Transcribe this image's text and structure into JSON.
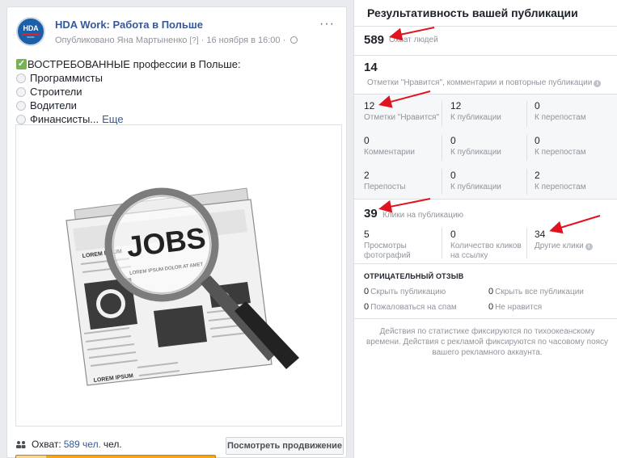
{
  "post": {
    "page_name": "HDA Work: Работа в Польше",
    "avatar_text": "HDA",
    "avatar_subtext": "WORK",
    "meta": "Опубликовано Яна Мартыненко",
    "meta_help": "[?]",
    "meta_date": "· 16 ноября в 16:00 ·",
    "more": "···",
    "intro_line": "ВОСТРЕБОВАННЫЕ профессии в Польше:",
    "list_items": [
      "Программисты",
      "Строители",
      "Водители",
      "Финансисты..."
    ],
    "see_more": "Еще",
    "image_words": {
      "jobs": "JOBS",
      "lorem1": "LOREM IPSUM",
      "lorem2": "LOREM IPSUM",
      "dolor": "LOREM IPSUM DOLOR AT AMET"
    },
    "reach_label": "Охват:",
    "reach_value": "589 чел.",
    "reach_unit": "чел.",
    "reach_fraction": 0.15,
    "boost_button": "Посмотреть продвижение"
  },
  "perf": {
    "title": "Результативность вашей публикации",
    "reach": {
      "value": "589",
      "label": "Охват людей"
    },
    "engagement": {
      "value": "14",
      "label": "Отметки \"Нравится\", комментарии и повторные публикации",
      "info": "i"
    },
    "grid": [
      [
        {
          "value": "12",
          "label": "Отметки \"Нравится\""
        },
        {
          "value": "12",
          "label": "К публикации"
        },
        {
          "value": "0",
          "label": "К перепостам"
        }
      ],
      [
        {
          "value": "0",
          "label": "Комментарии"
        },
        {
          "value": "0",
          "label": "К публикации"
        },
        {
          "value": "0",
          "label": "К перепостам"
        }
      ],
      [
        {
          "value": "2",
          "label": "Перепосты"
        },
        {
          "value": "0",
          "label": "К публикации"
        },
        {
          "value": "2",
          "label": "К перепостам"
        }
      ]
    ],
    "clicks": {
      "value": "39",
      "label": "Клики на публикацию"
    },
    "click_breakdown": [
      {
        "value": "5",
        "label": "Просмотры фотографий"
      },
      {
        "value": "0",
        "label": "Количество кликов на ссылку"
      },
      {
        "value": "34",
        "label": "Другие клики",
        "info": "i"
      }
    ],
    "negative_title": "ОТРИЦАТЕЛЬНЫЙ ОТЗЫВ",
    "negative": [
      {
        "value": "0",
        "label": "Скрыть публикацию"
      },
      {
        "value": "0",
        "label": "Скрыть все публикации"
      },
      {
        "value": "0",
        "label": "Пожаловаться на спам"
      },
      {
        "value": "0",
        "label": "Не нравится"
      }
    ],
    "footnote": "Действия по статистике фиксируются по тихоокеанскому времени. Действия с рекламой фиксируются по часовому поясу вашего рекламного аккаунта."
  },
  "colors": {
    "link": "#365899",
    "arrow": "#e0141e",
    "progress": "#f7a51d",
    "progress_fill": "#f9d78f",
    "avatar": "#1b5fa8"
  }
}
